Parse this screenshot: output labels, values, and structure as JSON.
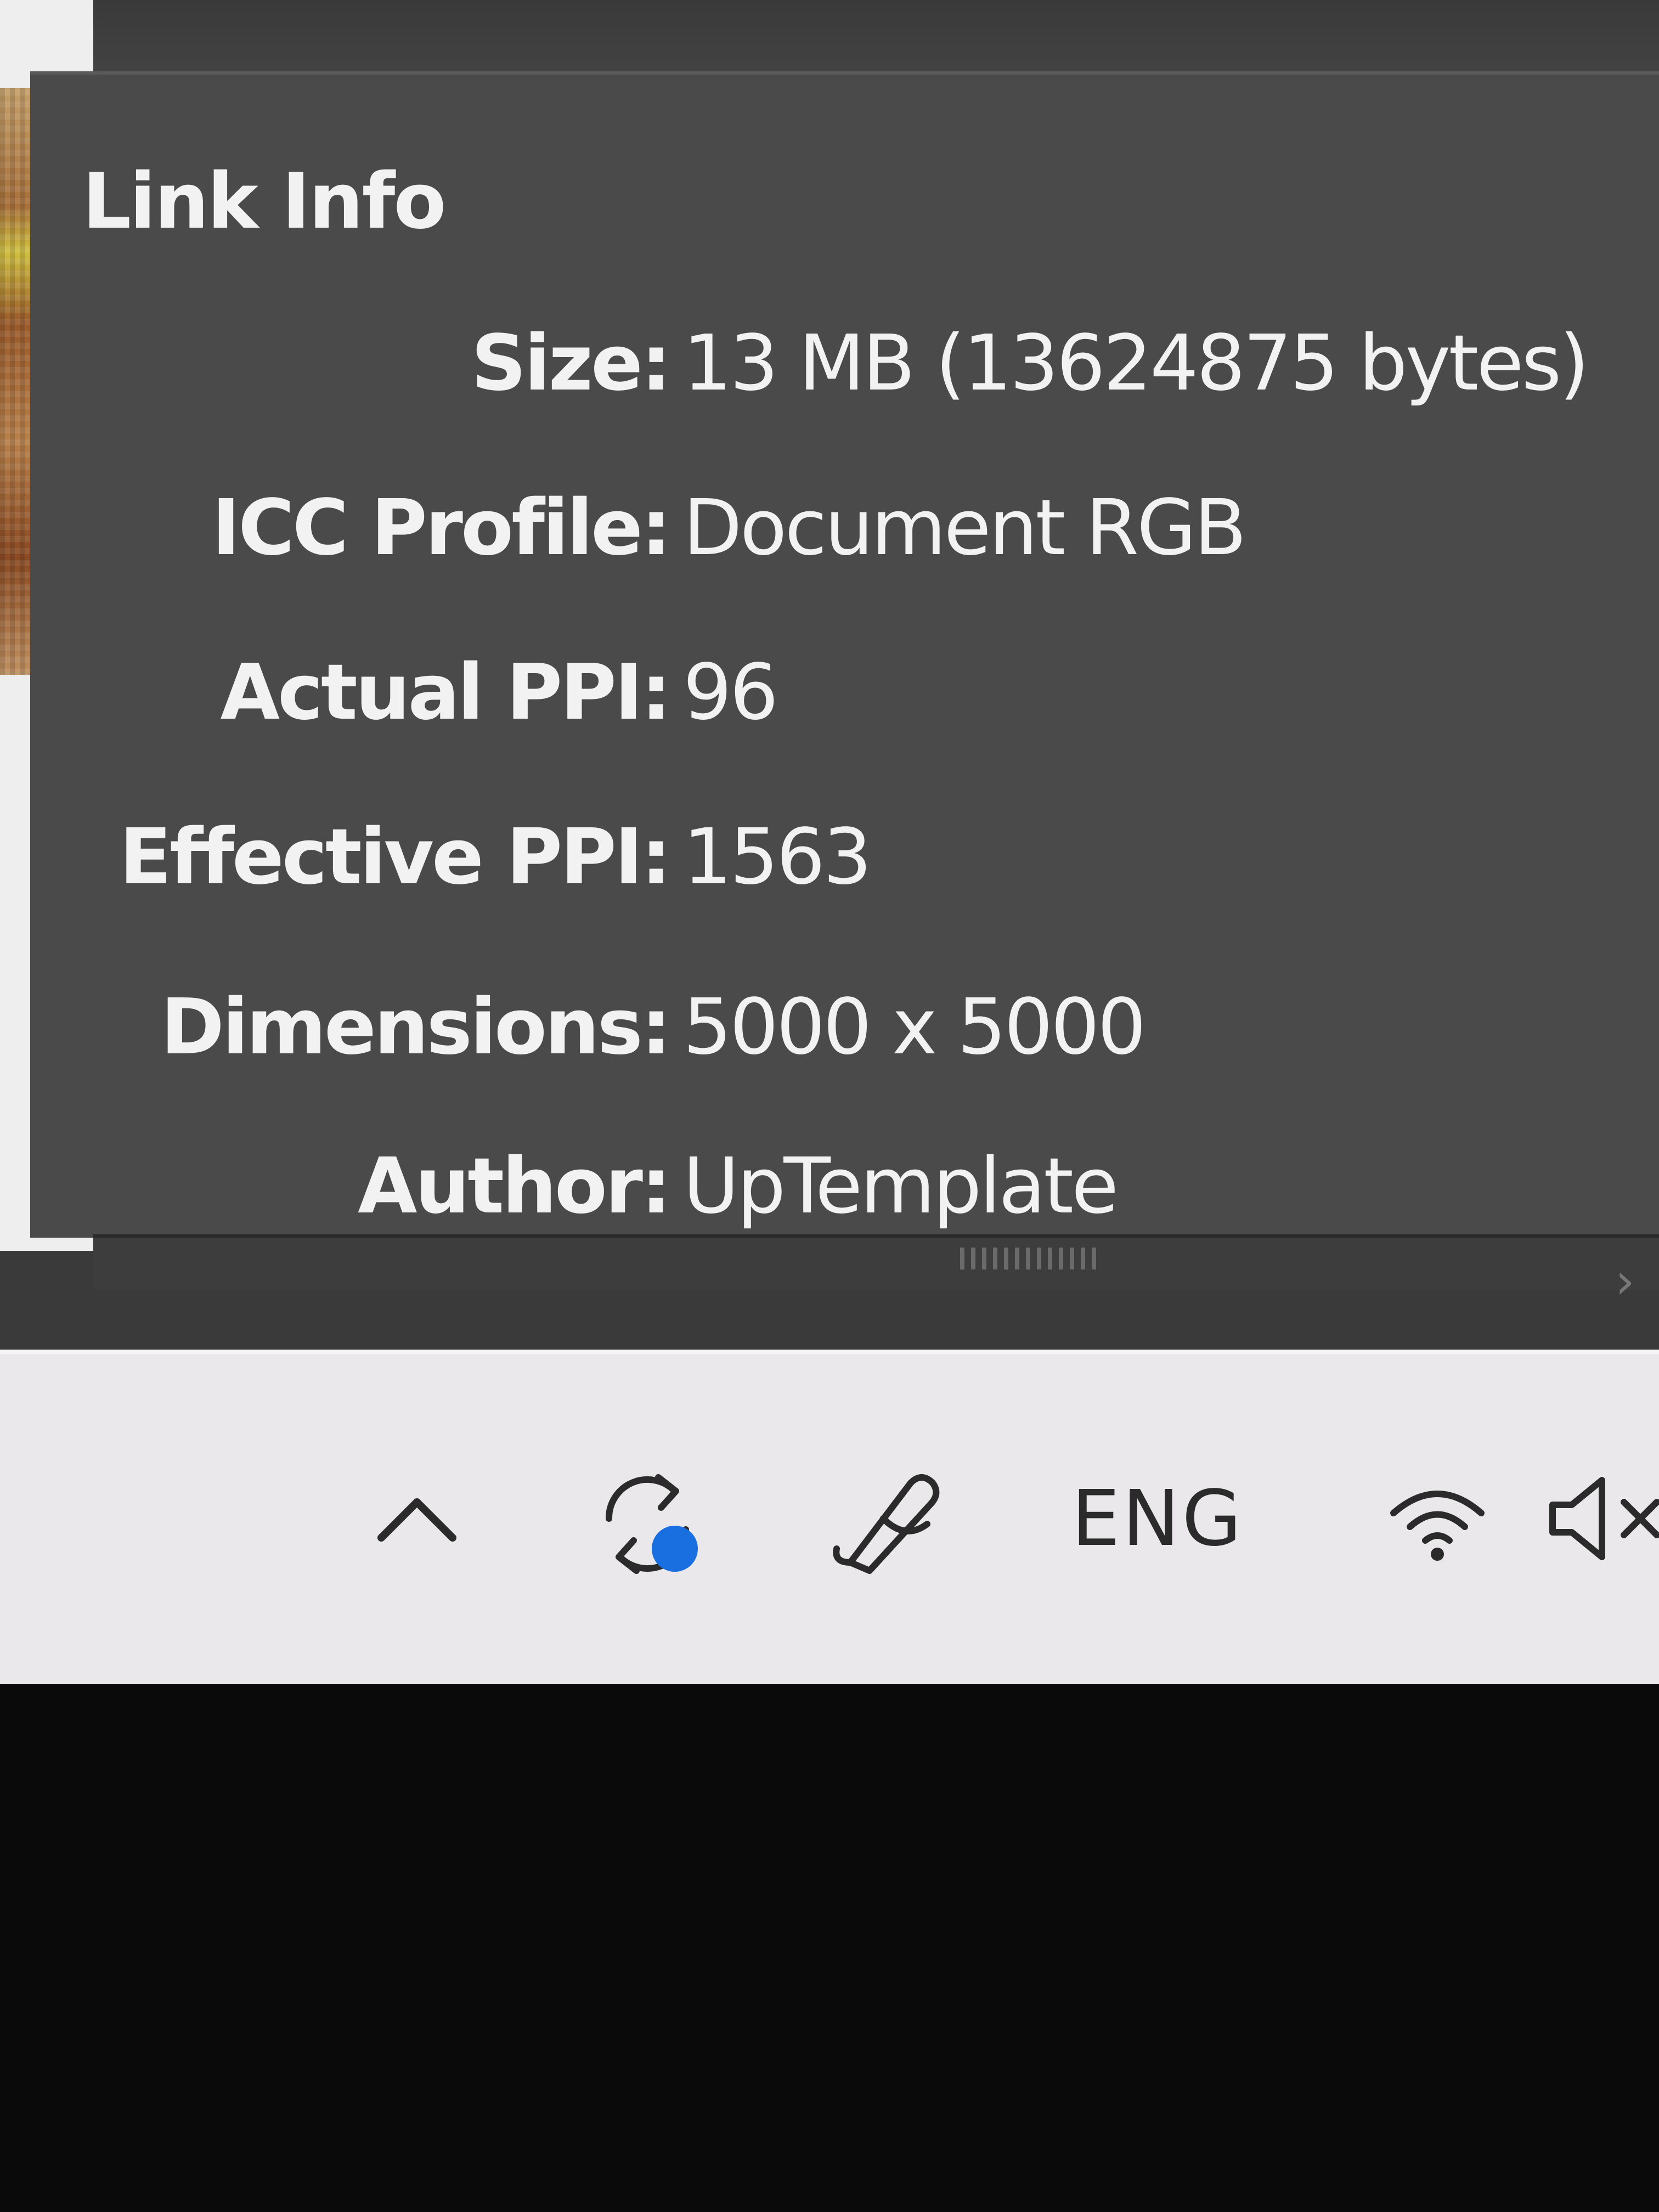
{
  "panel": {
    "title": "Link Info",
    "rows": [
      {
        "label": "Size:",
        "value": "13 MB (13624875 bytes)"
      },
      {
        "label": "ICC Profile:",
        "value": "Document RGB"
      },
      {
        "label": "Actual PPI:",
        "value": "96"
      },
      {
        "label": "Effective PPI:",
        "value": "1563"
      },
      {
        "label": "Dimensions:",
        "value": "5000 x 5000"
      },
      {
        "label": "Author:",
        "value": "UpTemplate"
      }
    ]
  },
  "taskbar": {
    "show_hidden_icons": "chevron-up-icon",
    "sync_icon": "sync-icon",
    "sync_badge_color": "#1a6fe0",
    "pen_icon": "pen-icon",
    "language": "ENG",
    "wifi_icon": "wifi-icon",
    "volume_icon": "volume-muted-icon"
  },
  "colors": {
    "panel_bg": "#4a4a4a",
    "panel_text": "#f2f2f2",
    "taskbar_bg": "#eae8ea"
  }
}
